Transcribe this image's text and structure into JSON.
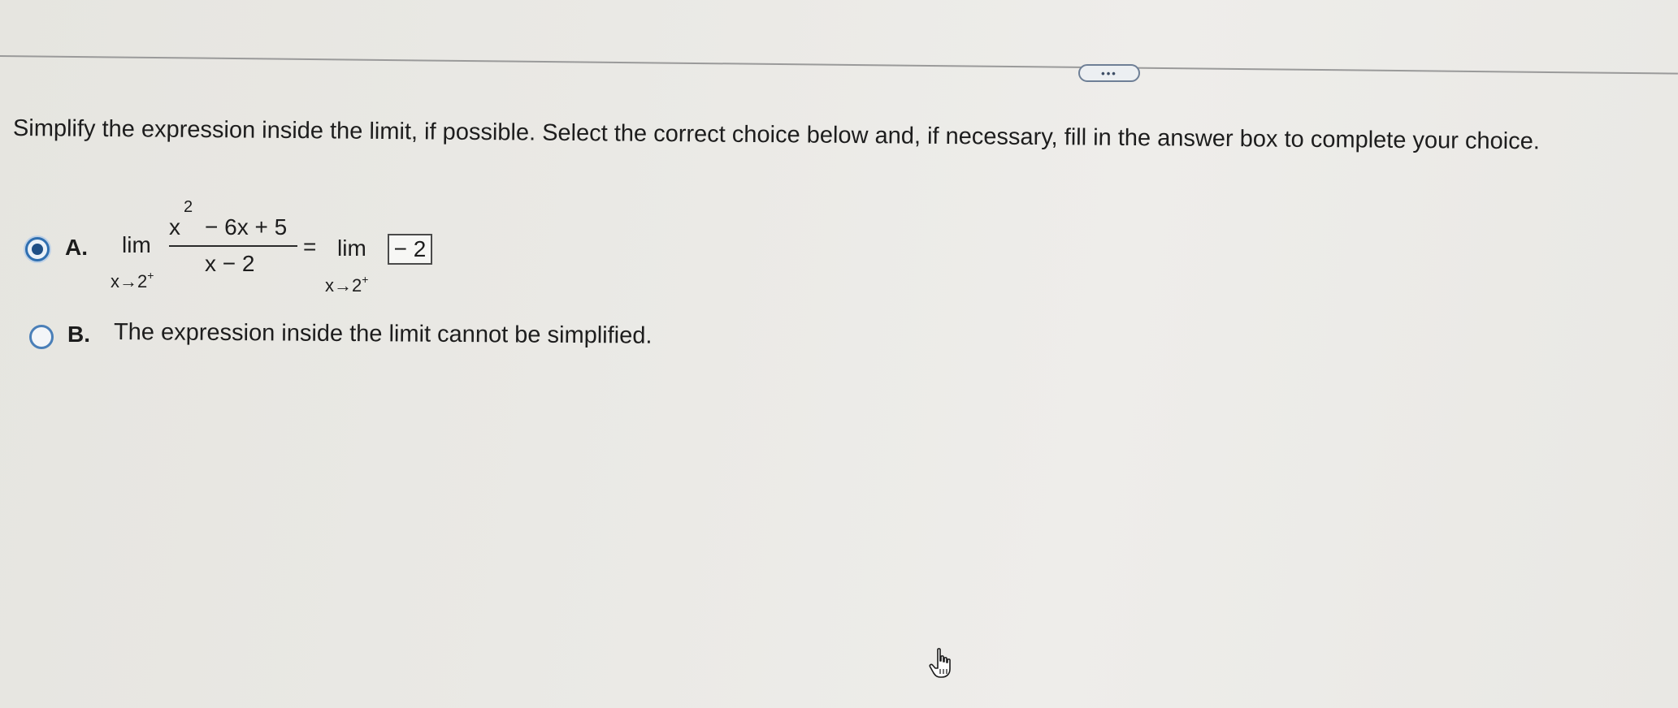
{
  "toolbar": {
    "more_label": "•••"
  },
  "question": {
    "instructions": "Simplify the expression inside the limit, if possible. Select the correct choice below and, if necessary, fill in the answer box to complete your choice."
  },
  "choices": [
    {
      "letter": "A.",
      "selected": true,
      "lim_label": "lim",
      "lim_sub": "x→2",
      "lim_sup": "+",
      "numerator_x": "x",
      "numerator_exp": "2",
      "numerator_rest": "− 6x + 5",
      "denominator": "x − 2",
      "equals": "=",
      "answer_value": "− 2"
    },
    {
      "letter": "B.",
      "selected": false,
      "text": "The expression inside the limit cannot be simplified."
    }
  ],
  "colors": {
    "radio_selected": "#2f6fb0",
    "radio_border": "#4a7fb8"
  },
  "icons": {
    "cursor": "hand-pointer-icon"
  }
}
